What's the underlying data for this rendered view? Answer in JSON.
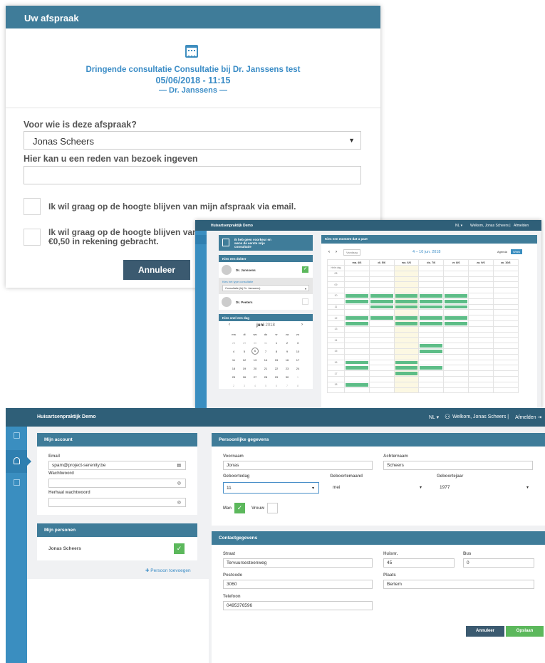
{
  "modal": {
    "title": "Uw afspraak",
    "appointment_line1": "Dringende consultatie Consultatie bij Dr. Janssens test",
    "appointment_line2": "05/06/2018 - 11:15",
    "appointment_line3": "— Dr. Janssens —",
    "for_whom_label": "Voor wie is deze afspraak?",
    "for_whom_value": "Jonas Scheers",
    "reason_label": "Hier kan u een reden van bezoek ingeven",
    "reason_value": "",
    "email_opt": "Ik wil graag op de hoogte blijven van mijn afspraak via email.",
    "sms_opt_line1": "Ik wil graag op de hoogte blijven van mi",
    "sms_opt_line2": "€0,50 in rekening gebracht.",
    "cancel_label": "Annuleer"
  },
  "calendar_app": {
    "brand": "Huisartsenpraktijk Demo",
    "lang": "NL ▾",
    "welcome": "Welkom, Jonas Scheers |",
    "logout": "Afmelden",
    "no_pref": "Ik heb geen voorkeur en wens de eerste vrije consultatie",
    "choose_doctor": "Kies een dokter",
    "doctors": [
      {
        "name": "Dr. Janssens",
        "checked": true
      },
      {
        "name": "Dr. Peeters",
        "checked": false
      }
    ],
    "consult_type_label": "Kies het type consultatie",
    "consult_type_value": "Consultatie (bij Dr. Janssens)",
    "choose_day": "Kies snel een dag",
    "mini_month": "juni",
    "mini_year": "2018",
    "weekday_heads": [
      "ma",
      "di",
      "wo",
      "do",
      "vr",
      "za",
      "zo"
    ],
    "mini_weeks": [
      [
        "28",
        "29",
        "30",
        "31",
        "1",
        "2",
        "3"
      ],
      [
        "4",
        "5",
        "6",
        "7",
        "8",
        "9",
        "10"
      ],
      [
        "11",
        "12",
        "13",
        "14",
        "15",
        "16",
        "17"
      ],
      [
        "18",
        "19",
        "20",
        "21",
        "22",
        "23",
        "24"
      ],
      [
        "25",
        "26",
        "27",
        "28",
        "29",
        "30",
        "1"
      ],
      [
        "2",
        "3",
        "4",
        "5",
        "6",
        "7",
        "8"
      ]
    ],
    "choose_moment": "Kies een moment dat u past",
    "today_btn": "Vandaag",
    "range": "4 – 10 jun. 2018",
    "view_agenda": "Agenda",
    "view_week": "Week",
    "day_heads": [
      "ma. 4/6",
      "di. 5/6",
      "wo. 6/6",
      "do. 7/6",
      "vr. 8/6",
      "za. 9/6",
      "zo. 10/6"
    ],
    "allday": "Hele dag",
    "hours": [
      "08",
      "",
      "09",
      "",
      "10",
      "",
      "11",
      "",
      "12",
      "",
      "13",
      "",
      "14",
      "",
      "15",
      "",
      "16",
      "",
      "17",
      "",
      "18",
      ""
    ]
  },
  "account": {
    "brand": "Huisartsenpraktijk Demo",
    "lang": "NL",
    "welcome": "Welkom, Jonas Scheers |",
    "logout": "Afmelden",
    "my_account": "Mijn account",
    "email_label": "Email",
    "email_value": "spam@project-serenity.be",
    "password_label": "Wachtwoord",
    "password_repeat_label": "Herhaal wachtwoord",
    "my_persons": "Mijn personen",
    "person_name": "Jonas Scheers",
    "add_person": "Persoon toevoegen",
    "personal": "Persoonlijke gegevens",
    "firstname_label": "Voornaam",
    "firstname": "Jonas",
    "lastname_label": "Achternaam",
    "lastname": "Scheers",
    "birthday_label": "Geboortedag",
    "birthday": "11",
    "birthmonth_label": "Geboortemaand",
    "birthmonth": "mei",
    "birthyear_label": "Geboortejaar",
    "birthyear": "1977",
    "man_label": "Man",
    "woman_label": "Vrouw",
    "contact": "Contactgegevens",
    "street_label": "Straat",
    "street": "Tervuursesteenweg",
    "number_label": "Huisnr.",
    "number": "45",
    "bus_label": "Bus",
    "bus": "0",
    "postcode_label": "Postcode",
    "postcode": "3060",
    "city_label": "Plaats",
    "city": "Bertem",
    "phone_label": "Telefoon",
    "phone": "0495376596",
    "cancel_label": "Annuleer",
    "save_label": "Opslaan"
  },
  "colors": {
    "header": "#3f7c99",
    "topbar": "#2f5f78",
    "rail": "#3a8ec0",
    "accent_text": "#3a8cc6",
    "success": "#5cb85c",
    "event": "#5dbd87"
  }
}
